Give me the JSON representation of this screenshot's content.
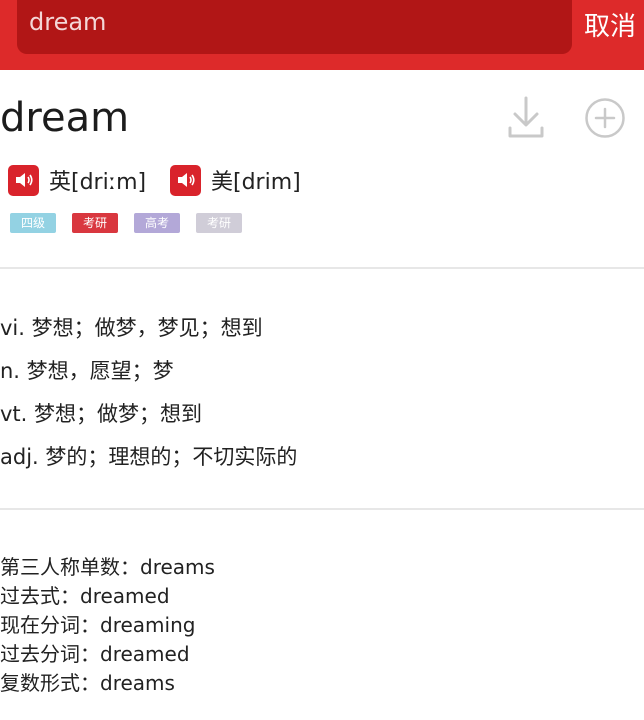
{
  "search": {
    "query": "dream",
    "cancel_label": "取消"
  },
  "entry": {
    "word": "dream",
    "pronunciations": [
      {
        "label": "英[driːm]"
      },
      {
        "label": "美[drim]"
      }
    ],
    "tags": [
      "四级",
      "考研",
      "高考",
      "考研"
    ],
    "definitions": [
      "vi. 梦想；做梦，梦见；想到",
      "n. 梦想，愿望；梦",
      "vt. 梦想；做梦；想到",
      "adj. 梦的；理想的；不切实际的"
    ],
    "forms": [
      "第三人称单数：dreams",
      "过去式：dreamed",
      "现在分词：dreaming",
      "过去分词：dreamed",
      "复数形式：dreams"
    ]
  },
  "icons": {
    "download": "download-icon",
    "add": "add-circle-icon",
    "speaker": "speaker-icon"
  },
  "colors": {
    "brand_red": "#dd2a2a",
    "search_bg": "#b11616",
    "speaker_red": "#d9232b"
  }
}
